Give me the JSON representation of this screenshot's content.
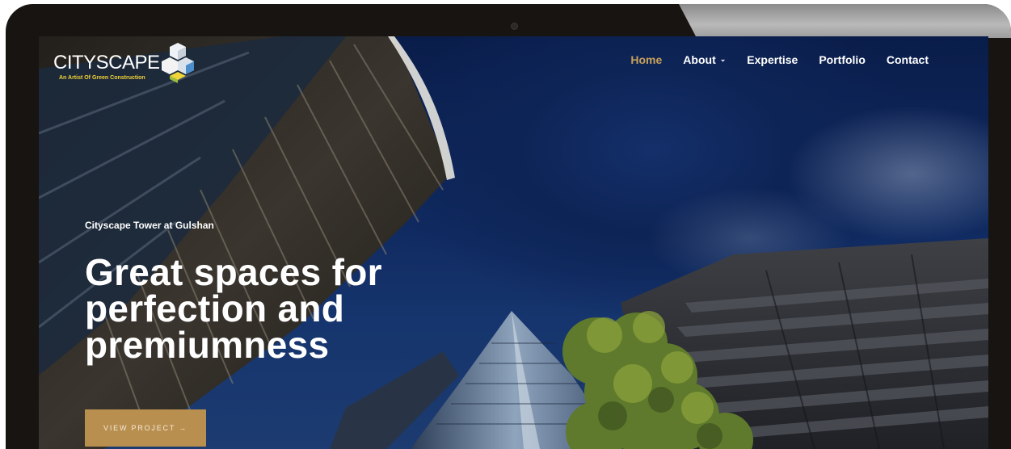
{
  "brand": {
    "name": "CITYSCAPE",
    "tagline": "An Artist Of Green Construction",
    "accent_color": "#c9a15b"
  },
  "nav": {
    "items": [
      {
        "label": "Home",
        "active": true
      },
      {
        "label": "About",
        "has_dropdown": true
      },
      {
        "label": "Expertise"
      },
      {
        "label": "Portfolio"
      },
      {
        "label": "Contact"
      }
    ]
  },
  "hero": {
    "eyebrow": "Cityscape Tower at Gulshan",
    "headline_lines": [
      "Great spaces for",
      "perfection and",
      "premiumness"
    ],
    "cta_label": "VIEW PROJECT",
    "cta_icon": "arrow-right-icon",
    "cta_color": "#b98f4f"
  },
  "icons": {
    "dropdown": "chevron-down-icon",
    "logo_mark": "cube-stack-icon"
  }
}
